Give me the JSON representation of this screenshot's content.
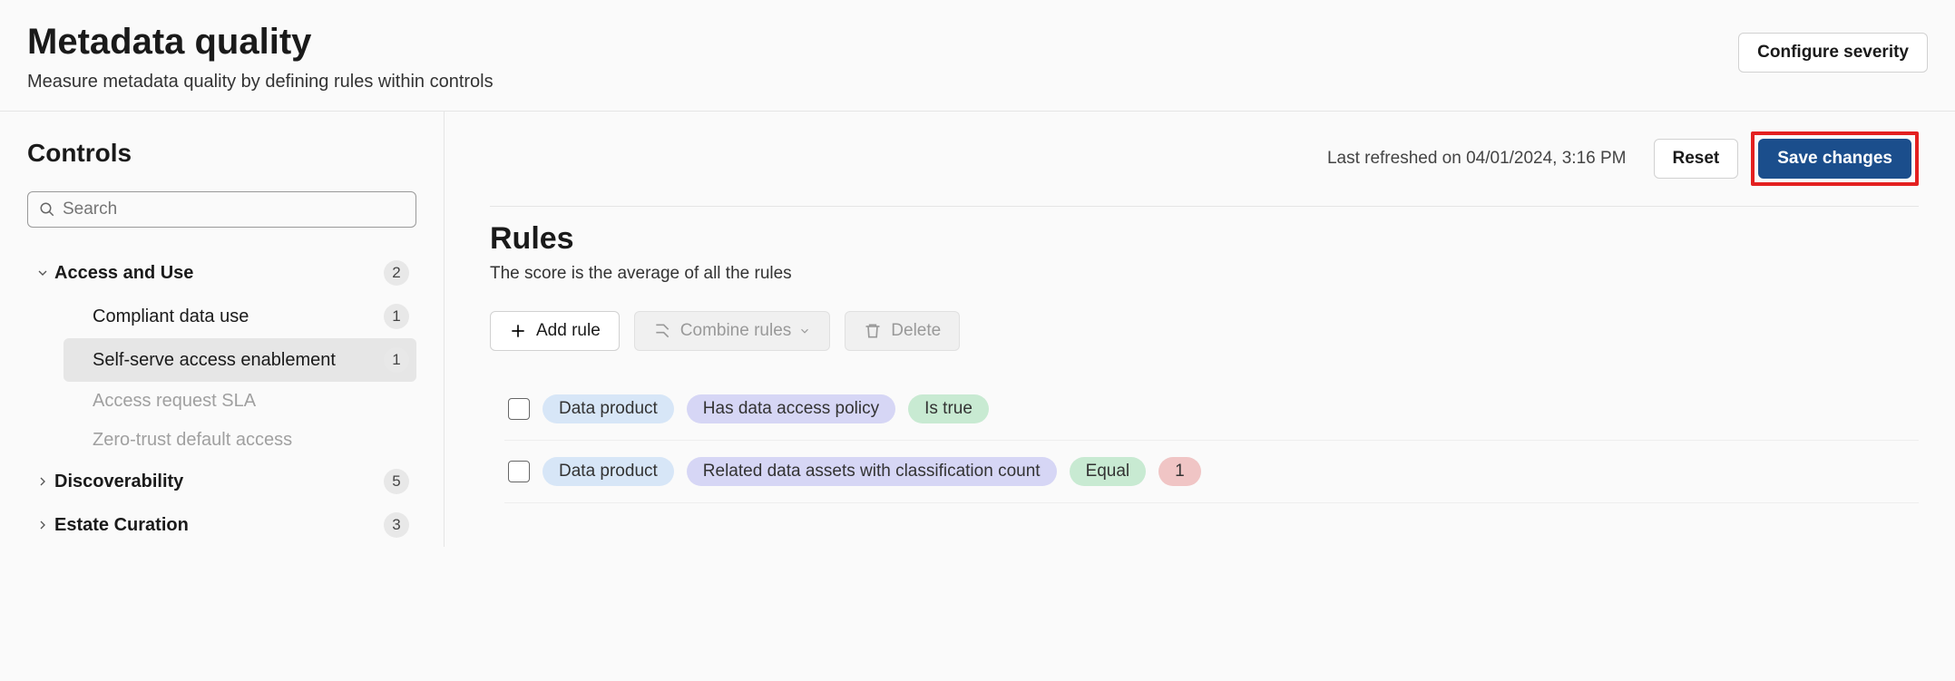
{
  "header": {
    "title": "Metadata quality",
    "subtitle": "Measure metadata quality by defining rules within controls",
    "configure_label": "Configure severity"
  },
  "sidebar": {
    "title": "Controls",
    "search_placeholder": "Search",
    "groups": [
      {
        "label": "Access and Use",
        "count": "2",
        "expanded": true,
        "items": [
          {
            "label": "Compliant data use",
            "count": "1",
            "muted": false,
            "selected": false
          },
          {
            "label": "Self-serve access enablement",
            "count": "1",
            "muted": false,
            "selected": true
          },
          {
            "label": "Access request SLA",
            "count": "",
            "muted": true,
            "selected": false
          },
          {
            "label": "Zero-trust default access",
            "count": "",
            "muted": true,
            "selected": false
          }
        ]
      },
      {
        "label": "Discoverability",
        "count": "5",
        "expanded": false,
        "items": []
      },
      {
        "label": "Estate Curation",
        "count": "3",
        "expanded": false,
        "items": []
      }
    ]
  },
  "topbar": {
    "refreshed": "Last refreshed on 04/01/2024, 3:16 PM",
    "reset_label": "Reset",
    "save_label": "Save changes"
  },
  "rules": {
    "title": "Rules",
    "subtitle": "The score is the average of all the rules",
    "toolbar": {
      "add": "Add rule",
      "combine": "Combine rules",
      "delete": "Delete"
    },
    "rows": [
      {
        "entity": "Data product",
        "attribute": "Has data access policy",
        "operator": "Is true",
        "value": ""
      },
      {
        "entity": "Data product",
        "attribute": "Related data assets with classification count",
        "operator": "Equal",
        "value": "1"
      }
    ]
  }
}
